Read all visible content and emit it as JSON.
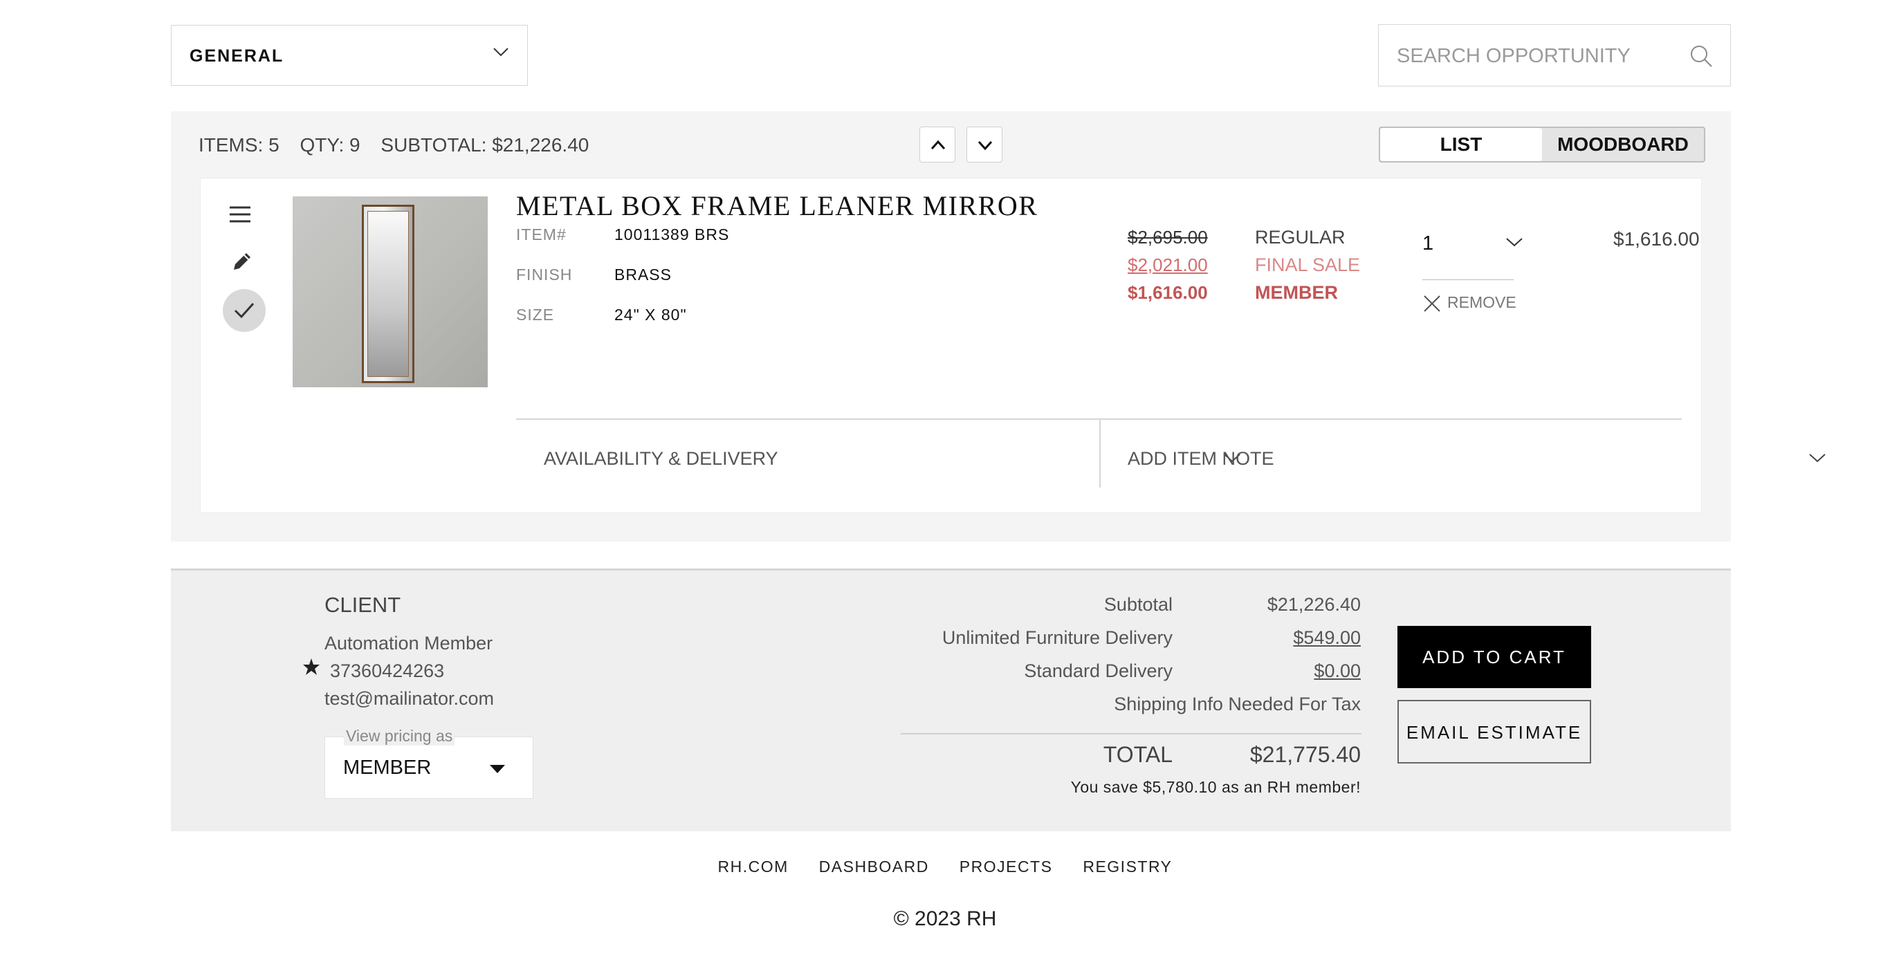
{
  "toolbar": {
    "room_dropdown": "GENERAL",
    "search_placeholder": "SEARCH OPPORTUNITY"
  },
  "items_summary": {
    "items": "ITEMS: 5",
    "qty": "QTY: 9",
    "subtotal": "SUBTOTAL: $21,226.40"
  },
  "view_toggle": {
    "list": "LIST",
    "moodboard": "MOODBOARD",
    "selected": "LIST"
  },
  "item": {
    "title": "METAL BOX FRAME LEANER MIRROR",
    "specs": [
      {
        "label": "ITEM#",
        "value": "10011389 BRS"
      },
      {
        "label": "FINISH",
        "value": "BRASS"
      },
      {
        "label": "SIZE",
        "value": "24\" X 80\""
      }
    ],
    "prices": [
      {
        "value": "$2,695.00",
        "type": "REGULAR"
      },
      {
        "value": "$2,021.00",
        "type": "FINAL SALE"
      },
      {
        "value": "$1,616.00",
        "type": "MEMBER"
      }
    ],
    "quantity": "1",
    "remove_label": "REMOVE",
    "line_total": "$1,616.00",
    "availability_label": "AVAILABILITY & DELIVERY",
    "note_label": "ADD ITEM NOTE"
  },
  "client": {
    "title": "CLIENT",
    "name": "Automation Member",
    "member_id": "37360424263",
    "email": "test@mailinator.com",
    "pricing_label": "View pricing as",
    "pricing_value": "MEMBER"
  },
  "totals": {
    "rows": [
      {
        "label": "Subtotal",
        "value": "$21,226.40"
      },
      {
        "label": "Unlimited Furniture Delivery",
        "value": "$549.00"
      },
      {
        "label": "Standard Delivery",
        "value": "$0.00"
      },
      {
        "label": "Shipping Info Needed For Tax",
        "value": ""
      }
    ],
    "total_label": "TOTAL",
    "total_value": "$21,775.40",
    "savings": "You save $5,780.10 as an RH member!"
  },
  "actions": {
    "add_to_cart": "ADD TO CART",
    "email_estimate": "EMAIL ESTIMATE"
  },
  "footer": {
    "links": [
      "RH.COM",
      "DASHBOARD",
      "PROJECTS",
      "REGISTRY"
    ],
    "copyright": "© 2023 RH"
  },
  "colors": {
    "member_red": "#c25454",
    "sale_red": "#d36d6d",
    "panel_gray": "#f4f4f4",
    "button_black": "#000000"
  }
}
